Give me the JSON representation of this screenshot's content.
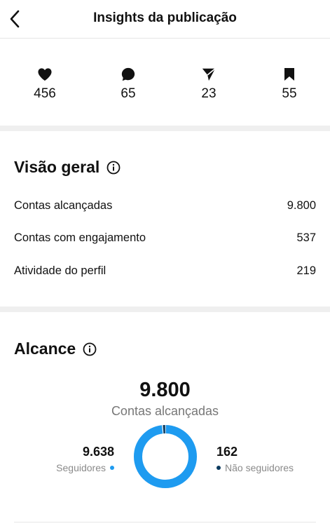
{
  "header": {
    "title": "Insights da publicação"
  },
  "stats": [
    {
      "icon": "heart-icon",
      "value": "456"
    },
    {
      "icon": "comment-icon",
      "value": "65"
    },
    {
      "icon": "share-icon",
      "value": "23"
    },
    {
      "icon": "bookmark-icon",
      "value": "55"
    }
  ],
  "overview": {
    "title": "Visão geral",
    "rows": [
      {
        "label": "Contas alcançadas",
        "value": "9.800"
      },
      {
        "label": "Contas com engajamento",
        "value": "537"
      },
      {
        "label": "Atividade do perfil",
        "value": "219"
      }
    ]
  },
  "reach": {
    "title": "Alcance",
    "total": "9.800",
    "total_label": "Contas alcançadas",
    "followers_value": "9.638",
    "followers_label": "Seguidores",
    "non_followers_value": "162",
    "non_followers_label": "Não seguidores",
    "followers_share": 0.983,
    "colors": {
      "followers": "#1e9bf0",
      "non_followers": "#0b3a5e"
    }
  }
}
